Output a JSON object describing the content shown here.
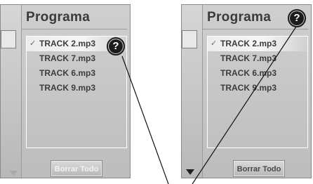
{
  "panels": [
    {
      "title": "Programa",
      "check_mark": "✓",
      "tracks": [
        "TRACK 2.mp3",
        "TRACK 7.mp3",
        "TRACK 6.mp3",
        "TRACK 9.mp3"
      ],
      "selected_index": 0,
      "help_glyph": "?",
      "clear_label": "Borrar Todo"
    },
    {
      "title": "Programa",
      "check_mark": "✓",
      "tracks": [
        "TRACK 2.mp3",
        "TRACK 7.mp3",
        "TRACK 6.mp3",
        "TRACK 9.mp3"
      ],
      "selected_index": 0,
      "help_glyph": "?",
      "clear_label": "Borrar Todo"
    }
  ],
  "colors": {
    "panel_bg": "#c8c8c8",
    "text_dark": "#3c3c3c",
    "icon_dark": "#1c1c1c"
  }
}
